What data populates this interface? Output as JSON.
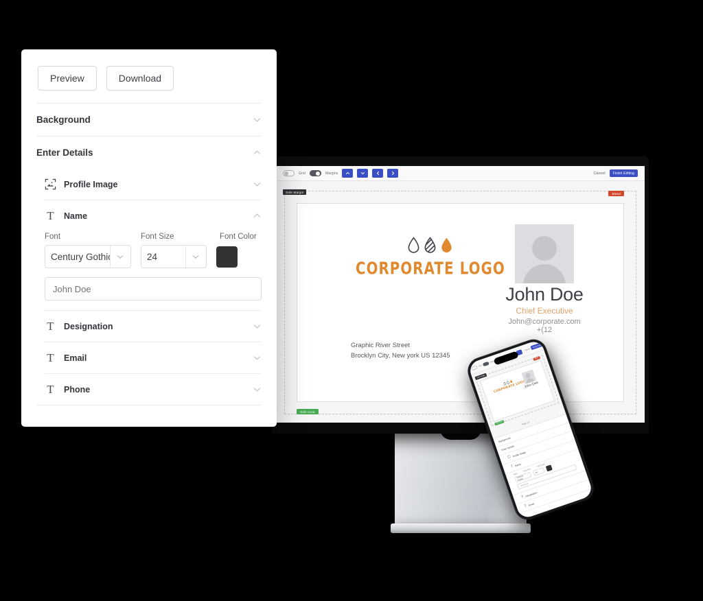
{
  "editor_panel": {
    "buttons": [
      {
        "label": "Preview",
        "name": "preview-button"
      },
      {
        "label": "Download",
        "name": "download-button"
      }
    ],
    "sections": [
      {
        "label": "Background",
        "state": "collapsed"
      },
      {
        "label": "Enter Details",
        "state": "expanded"
      }
    ],
    "subsections": [
      {
        "label": "Profile Image",
        "icon": "image-frame-icon",
        "state": "collapsed"
      },
      {
        "label": "Name",
        "icon": "text-icon",
        "state": "expanded"
      },
      {
        "label": "Designation",
        "icon": "text-icon",
        "state": "collapsed"
      },
      {
        "label": "Email",
        "icon": "text-icon",
        "state": "collapsed"
      },
      {
        "label": "Phone",
        "icon": "text-icon",
        "state": "collapsed"
      }
    ],
    "name_fields": {
      "font_label": "Font",
      "font_value": "Century Gothic",
      "size_label": "Font Size",
      "size_value": "24",
      "color_label": "Font Color",
      "color_value": "#333333",
      "text_value": "John Doe"
    }
  },
  "app_toolbar": {
    "grid_label": "Grid",
    "grid_on": false,
    "margins_label": "Margins",
    "margins_on": true,
    "cancel_label": "Cancel",
    "finish_label": "Finish Editing",
    "arrow_buttons": [
      "up",
      "down",
      "left",
      "right"
    ]
  },
  "canvas": {
    "ruler_tag": "Safe Margin",
    "badge_top_right": "Bleed",
    "badge_bottom_left": "Safe Area"
  },
  "business_card": {
    "logo_text": "CORPORATE LOGO",
    "logo_color": "#e0892f",
    "name": "John Doe",
    "role": "Chief Executive",
    "email": "John@corporate.com",
    "phone": "+(12",
    "address_line1": "Graphic River Street",
    "address_line2": "Brocklyn City, New york US 12345"
  },
  "phone_preview": {
    "pager_label": "Page  1/1"
  }
}
